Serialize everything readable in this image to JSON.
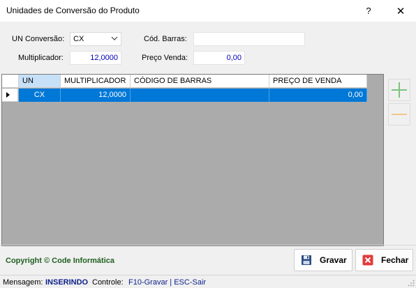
{
  "window": {
    "title": "Unidades de Conversão do Produto",
    "help_glyph": "?",
    "close_glyph": "✕"
  },
  "form": {
    "un_conversao_label": "UN Conversão:",
    "un_conversao_value": "CX",
    "cod_barras_label": "Cód. Barras:",
    "cod_barras_value": "",
    "multiplicador_label": "Multiplicador:",
    "multiplicador_value": "12,0000",
    "preco_venda_label": "Preço Venda:",
    "preco_venda_value": "0,00"
  },
  "grid": {
    "columns": [
      "UN",
      "MULTIPLICADOR",
      "CÓDIGO DE BARRAS",
      "PREÇO DE VENDA"
    ],
    "rows": [
      {
        "un": "CX",
        "multiplicador": "12,0000",
        "codigo_barras": "",
        "preco_venda": "0,00"
      }
    ]
  },
  "footer": {
    "copyright": "Copyright © Code Informática",
    "gravar_label": "Gravar",
    "fechar_label": "Fechar"
  },
  "status": {
    "mensagem_label": "Mensagem:",
    "mensagem_value": "INSERINDO",
    "controle_label": "Controle:",
    "controle_value": "F10-Gravar | ESC-Sair"
  },
  "colors": {
    "selection": "#0078d7",
    "grid_background": "#ababab",
    "add_icon": "#7dc37d",
    "remove_icon": "#f3c68a"
  }
}
